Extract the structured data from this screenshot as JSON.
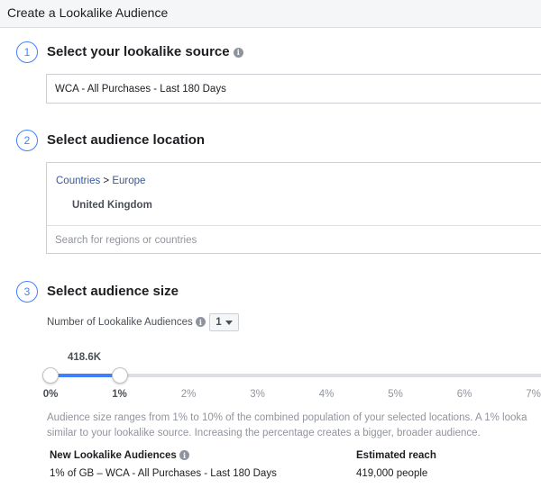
{
  "header": {
    "title": "Create a Lookalike Audience"
  },
  "steps": [
    {
      "number": "1",
      "title": "Select your lookalike source"
    },
    {
      "number": "2",
      "title": "Select audience location"
    },
    {
      "number": "3",
      "title": "Select audience size"
    }
  ],
  "source": {
    "value": "WCA - All Purchases - Last 180 Days"
  },
  "location": {
    "breadcrumb": {
      "countries": "Countries",
      "separator": ">",
      "region": "Europe"
    },
    "selected": "United Kingdom",
    "search_placeholder": "Search for regions or countries"
  },
  "size": {
    "num_label": "Number of Lookalike Audiences",
    "num_value": "1",
    "reach_label": "418.6K",
    "slider_range_percent": [
      0,
      1
    ],
    "ticks": [
      "0%",
      "1%",
      "2%",
      "3%",
      "4%",
      "5%",
      "6%",
      "7%"
    ],
    "description_line1": "Audience size ranges from 1% to 10% of the combined population of your selected locations. A 1% looka",
    "description_line2": "similar to your lookalike source. Increasing the percentage creates a bigger, broader audience."
  },
  "table": {
    "col1_header": "New Lookalike Audiences",
    "col2_header": "Estimated reach",
    "rows": [
      {
        "name": "1% of GB – WCA - All Purchases - Last 180 Days",
        "reach": "419,000 people"
      }
    ]
  },
  "colors": {
    "accent": "#4080ff",
    "link": "#385898",
    "muted": "#90949c"
  },
  "icons": {
    "info": "info-icon",
    "dropdown": "caret-down-icon"
  }
}
